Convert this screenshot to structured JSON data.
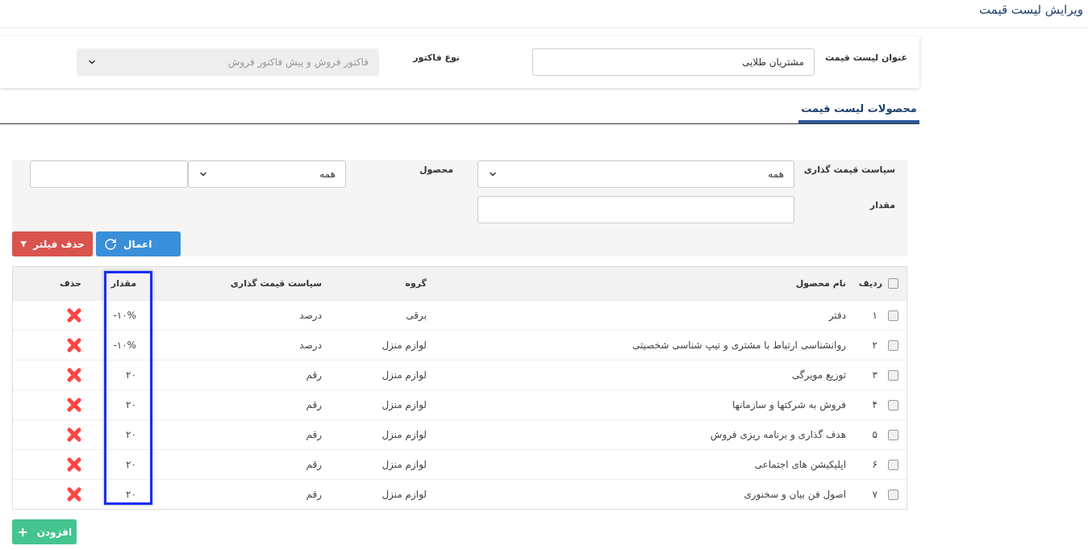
{
  "page": {
    "title": "ویرایش لیست قیمت"
  },
  "header_form": {
    "title_label": "عنوان لیست قیمت",
    "title_value": "مشتریان طلایی",
    "invoice_type_label": "نوع فاکتور",
    "invoice_type_value": "فاکتور فروش و پیش فاکتور فروش",
    "invoice_type_disabled": true
  },
  "tabs": [
    {
      "label": "محصولات لیست قیمت",
      "selected": true
    }
  ],
  "filters": {
    "policy_label": "سیاست قیمت گذاری",
    "policy_value": "همه",
    "product_label": "محصول",
    "product_value": "همه",
    "amount_label": "مقدار",
    "buttons": [
      {
        "label": "اعمال",
        "kind": "apply"
      },
      {
        "label": "حذف فیلتر",
        "kind": "clear"
      }
    ]
  },
  "table": {
    "select_all_checked": false,
    "columns": [
      {
        "label": "ردیف",
        "highlighted": false
      },
      {
        "label": "نام محصول",
        "highlighted": false
      },
      {
        "label": "گروه",
        "highlighted": false
      },
      {
        "label": "سیاست قیمت گذاری",
        "highlighted": false
      },
      {
        "label": "مقدار",
        "highlighted": true
      },
      {
        "label": "حذف",
        "highlighted": false
      }
    ],
    "rows": [
      {
        "checked": false,
        "index": "۱",
        "name": "دفتر",
        "group": "برقی",
        "policy": "درصد",
        "amount": "-۱۰%"
      },
      {
        "checked": false,
        "index": "۲",
        "name": "روانشناسی ارتباط با مشتری و تیپ شناسی شخصیتی",
        "group": "لوازم منزل",
        "policy": "درصد",
        "amount": "-۱۰%"
      },
      {
        "checked": false,
        "index": "۳",
        "name": "توزیع مویرگی",
        "group": "لوازم منزل",
        "policy": "رقم",
        "amount": "۲۰"
      },
      {
        "checked": false,
        "index": "۴",
        "name": "فروش به شرکتها و سازمانها",
        "group": "لوازم منزل",
        "policy": "رقم",
        "amount": "۲۰"
      },
      {
        "checked": false,
        "index": "۵",
        "name": "هدف گذاری و برنامه ریزی فروش",
        "group": "لوازم منزل",
        "policy": "رقم",
        "amount": "۲۰"
      },
      {
        "checked": false,
        "index": "۶",
        "name": "اپلیکیشن های اجتماعی",
        "group": "لوازم منزل",
        "policy": "رقم",
        "amount": "۲۰"
      },
      {
        "checked": false,
        "index": "۷",
        "name": "اصول فن بیان و سخنوری",
        "group": "لوازم منزل",
        "policy": "رقم",
        "amount": "۲۰"
      }
    ]
  },
  "add_button": {
    "label": "افزودن"
  }
}
